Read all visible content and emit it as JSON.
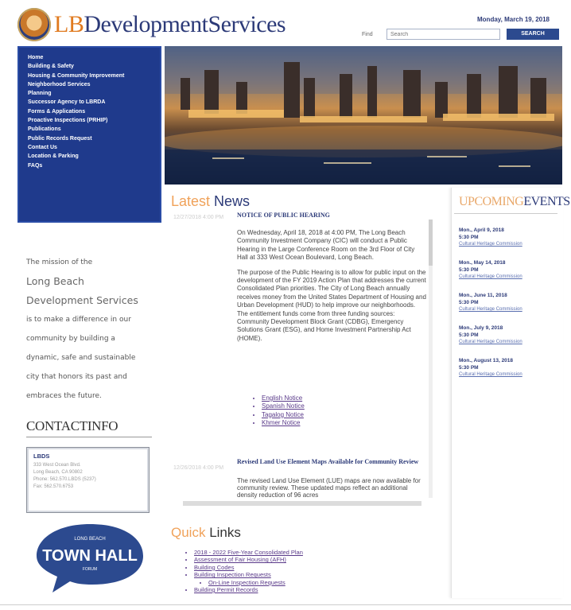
{
  "header": {
    "logo_lb": "LB",
    "logo_dev": "DevelopmentServices",
    "date": "Monday, March 19, 2018",
    "search_label": "Find",
    "search_placeholder": "Search",
    "search_button": "SEARCH"
  },
  "sidebar": {
    "items": [
      "Home",
      "Building & Safety",
      "Housing & Community Improvement",
      "Neighborhood Services",
      "Planning",
      "Successor Agency to LBRDA",
      "Forms & Applications",
      "Proactive Inspections (PRHIP)",
      "Publications",
      "Public Records Request",
      "Contact Us",
      "Location & Parking",
      "FAQs"
    ]
  },
  "mission": {
    "line1": "The mission of the",
    "line2": "Long Beach",
    "line3": "Development Services",
    "line4": "is to make a difference in our",
    "line5": "community by building a",
    "line6": "dynamic, safe and sustainable",
    "line7": "city that honors its past and",
    "line8": "embraces the future."
  },
  "contact": {
    "title": "CONTACTINFO",
    "org": "LBDS",
    "lines": [
      "333 West Ocean Blvd.",
      "Long Beach, CA 90802",
      "Phone: 562.570.LBDS (5237)",
      "Fax: 562.570.6753"
    ]
  },
  "townhall": {
    "top": "LONG BEACH",
    "main": "TOWN HALL",
    "bottom": "FORUM"
  },
  "news": {
    "title_a": "Latest",
    "title_b": " News",
    "item1": {
      "date": "12/27/2018 4:00 PM",
      "title": "NOTICE OF PUBLIC HEARING",
      "p1": "On Wednesday, April 18, 2018 at 4:00 PM, The Long Beach Community Investment Company (CIC) will conduct a Public Hearing in the Large Conference Room on the 3rd Floor of City Hall at 333 West Ocean Boulevard, Long Beach.",
      "p2": "The purpose of the Public Hearing is to allow for public input on the development of the FY 2019 Action Plan that addresses the current Consolidated Plan priorities. The City of Long Beach annually receives money from the United States Department of Housing and Urban Development (HUD) to help improve our neighborhoods. The entitlement funds come from three funding sources: Community Development Block Grant (CDBG), Emergency Solutions Grant (ESG), and Home Investment Partnership Act (HOME).",
      "notices": [
        "English Notice",
        "Spanish Notice",
        "Tagalog Notice",
        "Khmer Notice"
      ]
    },
    "item2": {
      "date": "12/26/2018 4:00 PM",
      "title": "Revised Land Use Element Maps Available for Community Review",
      "body": "The revised Land Use Element (LUE) maps are now available for community review. These updated maps reflect an additional density reduction of 96 acres"
    }
  },
  "events": {
    "title_a": "UPCOMING",
    "title_b": "EVENTS",
    "items": [
      {
        "date": "Mon., April 9, 2018",
        "time": "5:30 PM",
        "link": "Cultural Heritage Commission"
      },
      {
        "date": "Mon., May 14, 2018",
        "time": "5:30 PM",
        "link": "Cultural Heritage Commission"
      },
      {
        "date": "Mon., June 11, 2018",
        "time": "5:30 PM",
        "link": "Cultural Heritage Commission"
      },
      {
        "date": "Mon., July 9, 2018",
        "time": "5:30 PM",
        "link": "Cultural Heritage Commission"
      },
      {
        "date": "Mon., August 13, 2018",
        "time": "5:30 PM",
        "link": "Cultural Heritage Commission"
      }
    ]
  },
  "quick_links": {
    "title_a": "Quick",
    "title_b": " Links",
    "items": [
      "2018 - 2022 Five-Year Consolidated Plan",
      "Assessment of Fair Housing (AFH)",
      "Building Codes",
      "Building Inspection Requests",
      "On-Line Inspection Requests",
      "Building Permit Records"
    ]
  },
  "colors": {
    "brand_blue": "#2c3a78",
    "sidebar_blue": "#1f3a8c",
    "accent_orange": "#e07a1f"
  }
}
